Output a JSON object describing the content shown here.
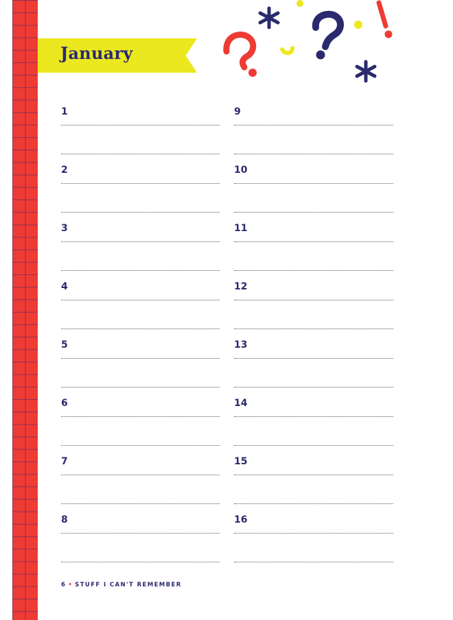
{
  "month_title": "January",
  "days": {
    "left": [
      "1",
      "2",
      "3",
      "4",
      "5",
      "6",
      "7",
      "8"
    ],
    "right": [
      "9",
      "10",
      "11",
      "12",
      "13",
      "14",
      "15",
      "16"
    ]
  },
  "footer": {
    "page_number": "6",
    "bullet": "•",
    "book_title": "STUFF I CAN'T REMEMBER"
  },
  "colors": {
    "grid_strip": "#ee3b34",
    "banner": "#ebe81f",
    "ink_navy": "#2a2a6e",
    "accent_red": "#ee3b34"
  },
  "decorations": [
    "question-mark-red",
    "asterisk-navy",
    "question-mark-navy",
    "exclamation-red",
    "asterisk-navy",
    "comma-yellow",
    "dot-yellow"
  ]
}
